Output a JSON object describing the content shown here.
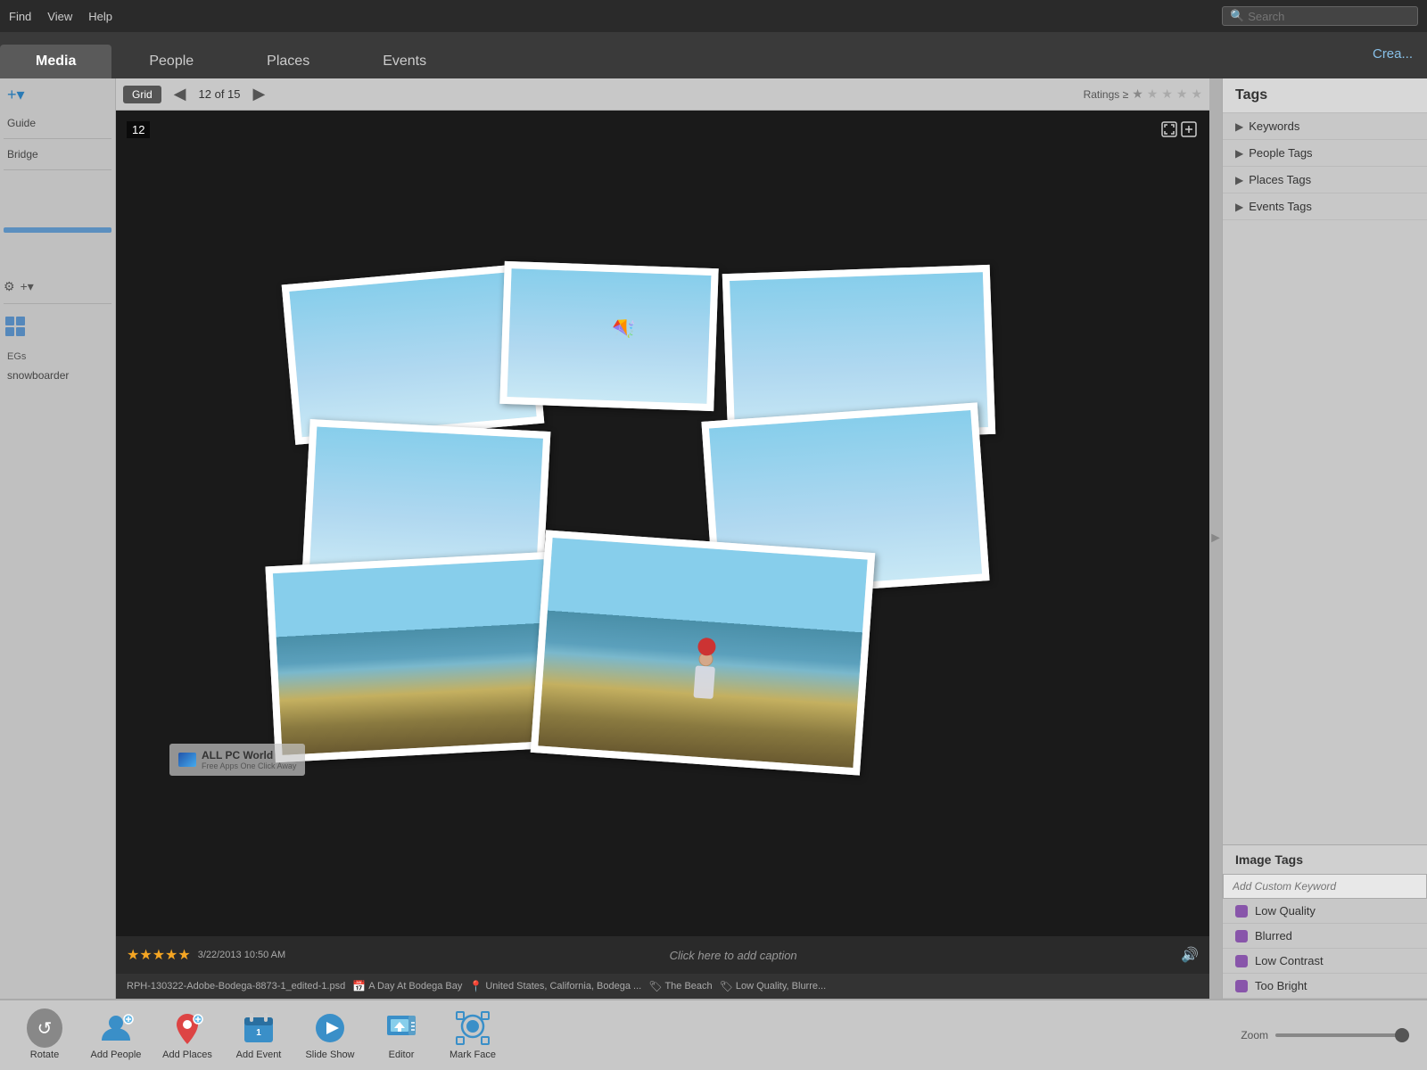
{
  "menubar": {
    "items": [
      "Find",
      "View",
      "Help"
    ],
    "search_placeholder": "Search"
  },
  "tabs": {
    "items": [
      "Media",
      "People",
      "Places",
      "Events"
    ],
    "active": "Media",
    "create_label": "Crea..."
  },
  "toolbar": {
    "grid_label": "Grid",
    "nav_prev": "◀",
    "nav_next": "▶",
    "counter": "12 of 15",
    "ratings_label": "Ratings ≥",
    "stars": [
      "★",
      "★",
      "★",
      "★",
      "★"
    ]
  },
  "image": {
    "number": "12",
    "watermark_title": "ALL PC World",
    "watermark_subtitle": "Free Apps One Click Away",
    "star_rating": "★★★★★",
    "date_time": "3/22/2013 10:50 AM",
    "caption": "Click here to add caption",
    "filename": "RPH-130322-Adobe-Bodega-8873-1_edited-1.psd",
    "tag1": "A Day At Bodega Bay",
    "location": "United States, California, Bodega ...",
    "tag2": "The Beach",
    "tag3": "Low Quality, Blurre..."
  },
  "right_panel": {
    "tags_header": "Tags",
    "categories": [
      {
        "label": "Keywords"
      },
      {
        "label": "People Tags"
      },
      {
        "label": "Places Tags"
      },
      {
        "label": "Events Tags"
      }
    ],
    "image_tags_header": "Image Tags",
    "keyword_placeholder": "Add Custom Keyword",
    "tag_items": [
      {
        "label": "Low Quality"
      },
      {
        "label": "Blurred"
      },
      {
        "label": "Low Contrast"
      },
      {
        "label": "Too Bright"
      }
    ]
  },
  "left_sidebar": {
    "add_tooltip": "+▾",
    "guide_label": "Guide",
    "bridge_label": "Bridge",
    "gear_icon": "⚙",
    "add_small": "+▾",
    "egs_label": "EGs",
    "snowboarder_label": "snowboarder"
  },
  "bottom_toolbar": {
    "tools": [
      {
        "label": "Rotate",
        "icon": "rotate"
      },
      {
        "label": "Add People",
        "icon": "add-people"
      },
      {
        "label": "Add Places",
        "icon": "add-places"
      },
      {
        "label": "Add Event",
        "icon": "add-event"
      },
      {
        "label": "Slide Show",
        "icon": "slideshow"
      },
      {
        "label": "Editor",
        "icon": "editor"
      },
      {
        "label": "Mark Face",
        "icon": "mark-face"
      }
    ],
    "zoom_label": "Zoom"
  }
}
